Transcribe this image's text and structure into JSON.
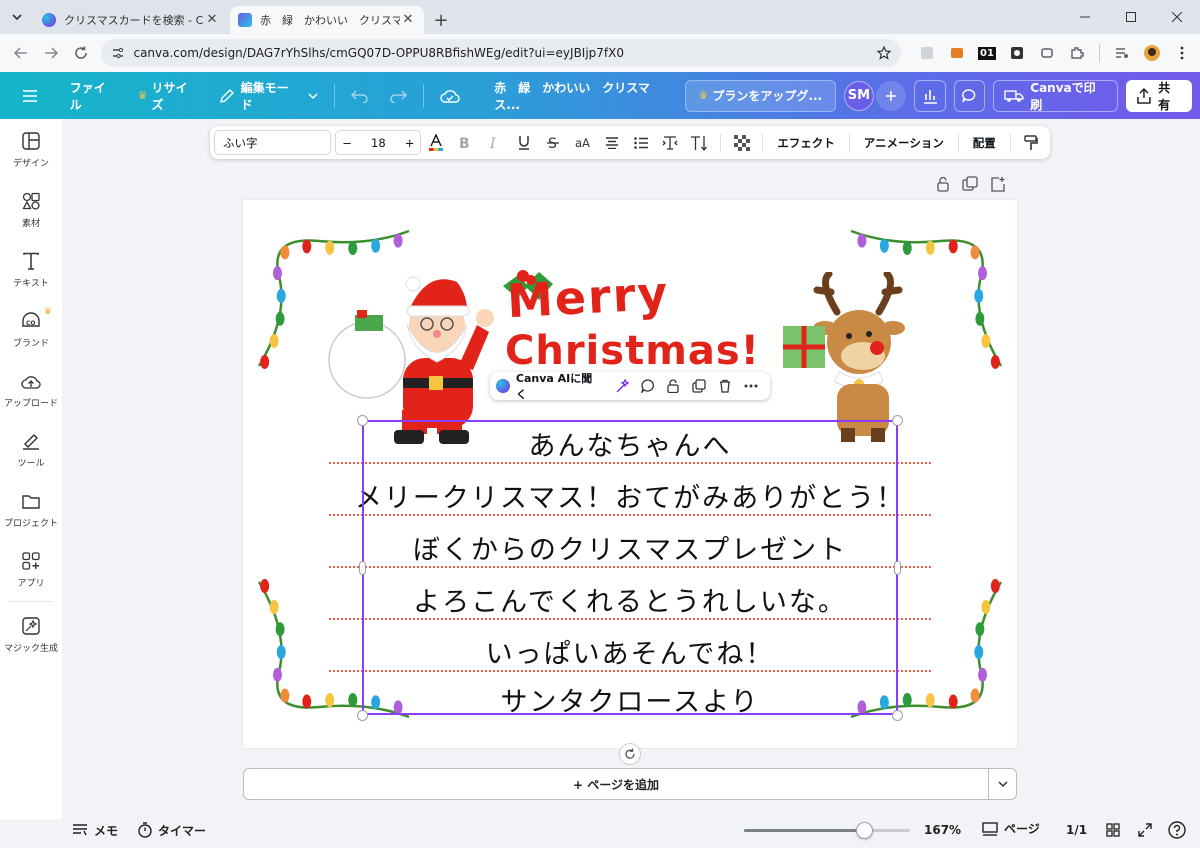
{
  "browser": {
    "tabs": [
      {
        "title": "クリスマスカードを検索 - Canva",
        "active": false
      },
      {
        "title": "赤　緑　かわいい　クリスマスカード",
        "active": true
      }
    ],
    "url": "canva.com/design/DAG7rYhSlhs/cmGQ07D-OPPU8RBfishWEg/edit?ui=eyJBIjp7fX0",
    "extension_badge": "01"
  },
  "header": {
    "file_label": "ファイル",
    "resize_label": "リサイズ",
    "edit_mode_label": "編集モード",
    "doc_title": "赤　緑　かわいい　クリスマス...",
    "upgrade_label": "プランをアップグ...",
    "avatar_initials": "SM",
    "print_label": "Canvaで印刷",
    "share_label": "共有",
    "colors": {
      "gradient_start": "#15b5c9",
      "gradient_end": "#7459ea",
      "crown": "#f5a623"
    }
  },
  "sidebar": {
    "items": [
      {
        "label": "デザイン",
        "icon": "layout-icon"
      },
      {
        "label": "素材",
        "icon": "elements-icon"
      },
      {
        "label": "テキスト",
        "icon": "text-icon"
      },
      {
        "label": "ブランド",
        "icon": "brand-icon"
      },
      {
        "label": "アップロード",
        "icon": "upload-icon"
      },
      {
        "label": "ツール",
        "icon": "draw-icon"
      },
      {
        "label": "プロジェクト",
        "icon": "folder-icon"
      },
      {
        "label": "アプリ",
        "icon": "apps-icon"
      },
      {
        "label": "マジック生成",
        "icon": "magic-media-icon"
      }
    ]
  },
  "text_toolbar": {
    "font": "ふい字",
    "font_size": "18",
    "case_label": "aA",
    "effects_label": "エフェクト",
    "animation_label": "アニメーション",
    "position_label": "配置",
    "text_color": "#e2231a"
  },
  "card": {
    "merry": "Merry",
    "christmas": "Christmas!",
    "message_lines": [
      "あんなちゃんへ",
      "メリークリスマス！おてがみありがとう！",
      "ぼくからのクリスマスプレゼント",
      "よろこんでくれるとうれしいな。",
      "いっぱいあそんでね！",
      "サンタクロースより"
    ],
    "title_color": "#e2231a",
    "line_color": "#ef5a4a",
    "selection_color": "#8b3dff"
  },
  "context_bar": {
    "ai_label": "Canva AIに聞く"
  },
  "add_page_label": "+ ページを追加",
  "footer": {
    "notes_label": "メモ",
    "timer_label": "タイマー",
    "zoom_fraction": 0.72,
    "zoom_label": "167%",
    "pages_label": "ページ",
    "page_count": "1/1"
  }
}
